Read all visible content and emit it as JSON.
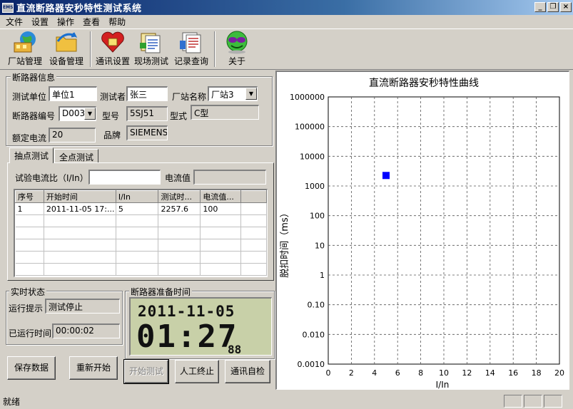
{
  "window": {
    "title": "直流断路器安秒特性测试系统",
    "icon": "app-icon"
  },
  "menu": [
    "文件",
    "设置",
    "操作",
    "查看",
    "帮助"
  ],
  "toolbar": [
    {
      "label": "厂站管理",
      "icon": "factory-globe-icon"
    },
    {
      "label": "设备管理",
      "icon": "folder-arrow-icon"
    },
    {
      "label": "通讯设置",
      "icon": "heart-icon"
    },
    {
      "label": "现场测试",
      "icon": "documents-icon"
    },
    {
      "label": "记录查询",
      "icon": "records-icon"
    },
    {
      "label": "关于",
      "icon": "about-glasses-icon"
    }
  ],
  "breaker_info": {
    "title": "断路器信息",
    "test_unit_label": "测试单位",
    "test_unit_value": "单位1",
    "tester_label": "测试者",
    "tester_value": "张三",
    "station_label": "厂站名称",
    "station_value": "厂站3",
    "breaker_no_label": "断路器编号",
    "breaker_no_value": "D003",
    "model_label": "型号",
    "model_value": "5SJ51",
    "form_label": "型式",
    "form_value": "C型",
    "rated_current_label": "额定电流",
    "rated_current_value": "20",
    "brand_label": "品牌",
    "brand_value": "SIEMENS"
  },
  "tabs": [
    "抽点测试",
    "全点测试"
  ],
  "spot_test": {
    "ratio_label": "试验电流比（I/In）",
    "ratio_value": "",
    "current_label": "电流值",
    "current_value": ""
  },
  "grid": {
    "columns": [
      "序号",
      "开始时间",
      "I/In",
      "测试时...",
      "电流值..."
    ],
    "rows": [
      [
        "1",
        "2011-11-05 17:...",
        "5",
        "2257.6",
        "100"
      ]
    ]
  },
  "realtime": {
    "title": "实时状态",
    "prompt_label": "运行提示",
    "prompt_value": "测试停止",
    "elapsed_label": "已运行时间",
    "elapsed_value": "00:00:02"
  },
  "prep_time": {
    "title": "断路器准备时间",
    "date": "2011-11-05",
    "time": "01:27",
    "ms": "88"
  },
  "buttons": {
    "save": "保存数据",
    "restart": "重新开始",
    "start": "开始测试",
    "stop": "人工终止",
    "selfcheck": "通讯自检"
  },
  "statusbar": {
    "text": "就绪"
  },
  "chart_data": {
    "type": "scatter",
    "title": "直流断路器安秒特性曲线",
    "xlabel": "I/In",
    "ylabel": "脱扣时间（ms）",
    "xlim": [
      0,
      20
    ],
    "x_ticks": [
      "0",
      "2",
      "4",
      "6",
      "8",
      "10",
      "12",
      "14",
      "16",
      "18",
      "20"
    ],
    "ylim": [
      0.001,
      1000000
    ],
    "y_scale": "log",
    "y_ticks": [
      "1000000",
      "100000",
      "10000",
      "1000",
      "100",
      "10",
      "1",
      "0.10",
      "0.010",
      "0.0010"
    ],
    "grid": true,
    "points": [
      {
        "x": 5,
        "y": 2257.6
      }
    ],
    "marker_color": "#0000ff"
  }
}
